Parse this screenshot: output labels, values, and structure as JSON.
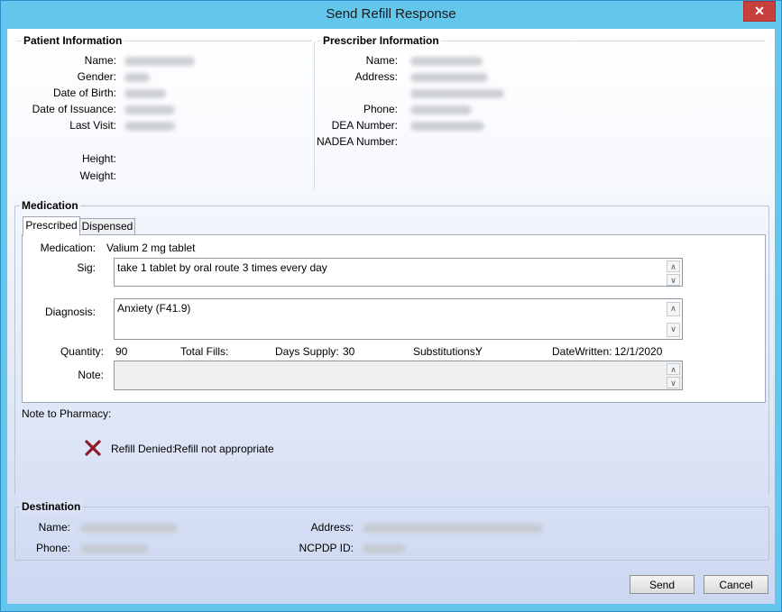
{
  "window": {
    "title": "Send Refill Response",
    "close_glyph": "✕"
  },
  "patient": {
    "section_title": "Patient Information",
    "labels": {
      "name": "Name:",
      "gender": "Gender:",
      "dob": "Date of Birth:",
      "issuance": "Date of Issuance:",
      "last_visit": "Last Visit:",
      "height": "Height:",
      "weight": "Weight:"
    }
  },
  "prescriber": {
    "section_title": "Prescriber Information",
    "labels": {
      "name": "Name:",
      "address": "Address:",
      "phone": "Phone:",
      "dea": "DEA Number:",
      "nadea": "NADEA Number:"
    }
  },
  "medication": {
    "section_title": "Medication",
    "tabs": [
      {
        "label": "Prescribed",
        "active": true
      },
      {
        "label": "Dispensed",
        "active": false
      }
    ],
    "labels": {
      "medication": "Medication:",
      "sig": "Sig:",
      "diagnosis": "Diagnosis:",
      "quantity": "Quantity:",
      "total_fills": "Total Fills:",
      "days_supply": "Days Supply:",
      "substitutions": "Substitutions:",
      "date_written": "DateWritten:",
      "note": "Note:"
    },
    "values": {
      "medication": "Valium 2 mg tablet",
      "sig": "take 1 tablet by oral route 3 times every day",
      "diagnosis": "Anxiety (F41.9)",
      "quantity": "90",
      "total_fills": "",
      "days_supply": "30",
      "substitutions": "Y",
      "date_written": "12/1/2020",
      "note": ""
    }
  },
  "pharmacy_note": {
    "label": "Note to Pharmacy:",
    "status_icon": "x-mark-icon",
    "status_color": "#8b1a2b",
    "status_label": "Refill Denied:",
    "status_text": "Refill not appropriate"
  },
  "destination": {
    "section_title": "Destination",
    "labels": {
      "name": "Name:",
      "phone": "Phone:",
      "address": "Address:",
      "ncpdp": "NCPDP ID:"
    }
  },
  "buttons": {
    "send": "Send",
    "cancel": "Cancel"
  },
  "scroll": {
    "up": "∧",
    "down": "∨"
  }
}
